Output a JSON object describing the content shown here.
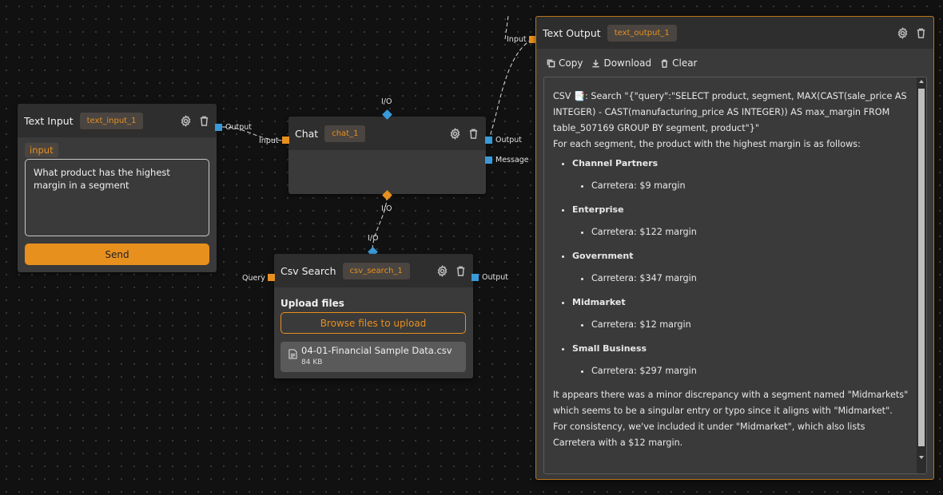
{
  "text_input": {
    "title": "Text Input",
    "id": "text_input_1",
    "input_label": "input",
    "value": "What product has the highest margin in a segment",
    "send_label": "Send",
    "output_label": "Output"
  },
  "chat": {
    "title": "Chat",
    "id": "chat_1",
    "input_label": "Input",
    "output_label": "Output",
    "message_label": "Message",
    "top_io_label": "I/O",
    "bottom_io_label": "I/O"
  },
  "csv_search": {
    "title": "Csv Search",
    "id": "csv_search_1",
    "query_label": "Query",
    "output_label": "Output",
    "io_label": "I/O",
    "upload_label": "Upload files",
    "browse_label": "Browse files to upload",
    "file_name": "04-01-Financial Sample Data.csv",
    "file_size": "84 KB"
  },
  "text_output": {
    "title": "Text Output",
    "id": "text_output_1",
    "input_label": "Input",
    "copy_label": "Copy",
    "download_label": "Download",
    "clear_label": "Clear",
    "content": {
      "intro": "CSV 📑: Search \"{\"query\":\"SELECT product, segment, MAX(CAST(sale_price AS INTEGER) - CAST(manufacturing_price AS INTEGER)) AS max_margin FROM table_507169 GROUP BY segment, product\"}\"",
      "lead": "For each segment, the product with the highest margin is as follows:",
      "segments": [
        {
          "name": "Channel Partners",
          "detail": "Carretera: $9 margin"
        },
        {
          "name": "Enterprise",
          "detail": "Carretera: $122 margin"
        },
        {
          "name": "Government",
          "detail": "Carretera: $347 margin"
        },
        {
          "name": "Midmarket",
          "detail": "Carretera: $12 margin"
        },
        {
          "name": "Small Business",
          "detail": "Carretera: $297 margin"
        }
      ],
      "closing": "It appears there was a minor discrepancy with a segment named \"Midmarkets\" which seems to be a singular entry or typo since it aligns with \"Midmarket\". For consistency, we've included it under \"Midmarket\", which also lists Carretera with a $12 margin."
    }
  },
  "colors": {
    "accent": "#e8901e",
    "port_blue": "#3a9ad9",
    "canvas": "#111111",
    "node": "#3a3a3a"
  },
  "icons": [
    "gear-icon",
    "trash-icon",
    "copy-icon",
    "download-icon",
    "file-icon"
  ]
}
